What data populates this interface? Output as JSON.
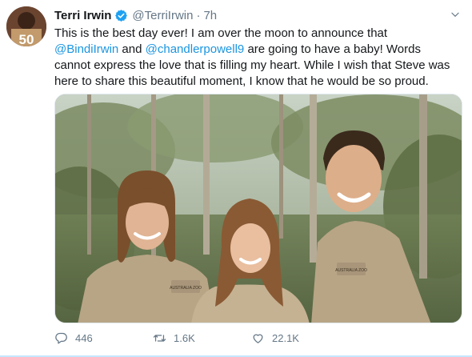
{
  "tweet": {
    "author_name": "Terri Irwin",
    "author_handle": "@TerriIrwin",
    "separator": "·",
    "timestamp": "7h",
    "avatar_badge": "50",
    "text_lines": [
      {
        "pre": "This is the best day ever! I am over the moon to announce that",
        "m1": "",
        "mid": "",
        "m2": "",
        "post": ""
      },
      {
        "pre": "",
        "m1": "@BindiIrwin",
        "mid": " and ",
        "m2": "@chandlerpowell9",
        "post": " are going to have a baby! Words"
      },
      {
        "pre": "cannot express the love that is filling my heart. While I wish that Steve was",
        "m1": "",
        "mid": "",
        "m2": "",
        "post": ""
      },
      {
        "pre": "here to share this beautiful moment, I know that he would be so proud.",
        "m1": "",
        "mid": "",
        "m2": "",
        "post": ""
      }
    ],
    "shirt_patch_left": "AUSTRALIA ZOO",
    "shirt_patch_right": "AUSTRALIA ZOO"
  },
  "actions": {
    "replies": "446",
    "retweets": "1.6K",
    "likes": "22.1K"
  },
  "icons": {
    "verified": "verified-badge-icon",
    "caret": "chevron-down-icon",
    "reply": "reply-icon",
    "retweet": "retweet-icon",
    "like": "heart-icon"
  },
  "colors": {
    "link": "#1b95e0",
    "muted": "#657786",
    "verified": "#1da1f2"
  }
}
